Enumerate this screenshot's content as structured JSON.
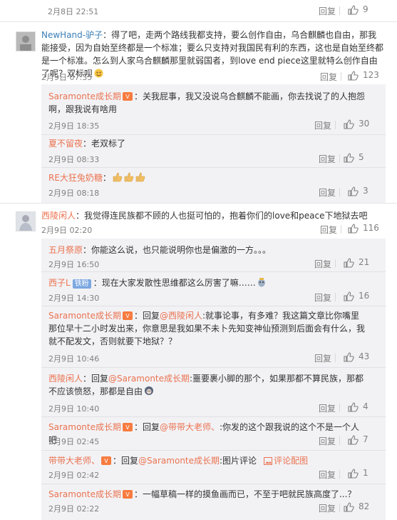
{
  "reply_label": "回复",
  "top": {
    "time": "2月8日 22:51",
    "likes": "9"
  },
  "comment1": {
    "user": "NewHand-驴子",
    "text": "：得了吧，走两个路线我都支持，要么创作自由，乌合麒麟也自由，那我能接受，因为自始至终都是一个标准；要么只支持对我国民有利的东西，这也是自始至终都是一个标准。怎么到人家乌合麒麟那里就弱国者，到love end piece这里就特么创作自由了呢？双标呗",
    "time": "2月9日 07:35",
    "likes": "123",
    "replies": [
      {
        "user": "Saramonte成长期",
        "text": "：关我屁事，我又没说乌合麒麟不能画，你去找说了的人抱怨啊，跟我说有啥用",
        "time": "2月9日 18:35",
        "likes": "30"
      },
      {
        "user": "夏不留夜",
        "text": "：老双标了",
        "time": "2月9日 08:33",
        "likes": "5"
      },
      {
        "user": "RE大狂兔奶糖",
        "text": "：",
        "time": "2月9日 08:18",
        "likes": "3"
      }
    ]
  },
  "comment2": {
    "user": "西陵闲人",
    "text": "：我觉得连民族都不顾的人也挺可怕的，抱着你们的love和peace下地狱去吧",
    "time": "2月9日 02:20",
    "likes": "116",
    "replies": [
      {
        "user": "五月祭原",
        "text": "：你能这么说，也只能说明你也是偏激的一方。。。",
        "time": "2月9日 16:50",
        "likes": "21"
      },
      {
        "user": "西子L",
        "badge": "铁粉",
        "text": "：现在大家发散性思维都这么厉害了嘛……",
        "time": "2月9日 14:30",
        "likes": "16"
      },
      {
        "user": "Saramonte成长期",
        "pre": "：回复",
        "mention": "@西陵闲人",
        "text": ":就事论事，有多难？我这篇文章比你嘴里那位早十二小时发出来，你意思是我如果不未卜先知变神仙预测到后面会有什么，我就不配发文，否则就要下地狱？？",
        "time": "2月9日 10:46",
        "likes": "43"
      },
      {
        "user": "西陵闲人",
        "pre": "：回复",
        "mention": "@Saramonte成长期",
        "text": ":噩要裹小脚的那个，如果那都不算民族，那都不应该愤怒，那都是自由",
        "time": "2月9日 10:40",
        "likes": "4"
      },
      {
        "user": "Saramonte成长期",
        "pre": "：回复",
        "mention": "@带带大老师、",
        "text": ":你发的这个跟我说的这个不是一个人吧",
        "time": "2月9日 02:45",
        "likes": "7"
      },
      {
        "user": "带带大老师、",
        "pre": "：回复",
        "mention": "@Saramonte成长期",
        "text": ":图片评论",
        "pic_link": "评论配图",
        "time": "2月9日 02:42",
        "likes": "1"
      },
      {
        "user": "Saramonte成长期",
        "text": "：一幅草稿一样的摸鱼画而已，不至于吧就民族高度了...？",
        "time": "2月9日 02:22",
        "likes": "82"
      }
    ]
  },
  "colors": {
    "username": "#eb7350",
    "text": "#333333",
    "muted": "#808080",
    "reply_bg": "#f2f2f5"
  }
}
